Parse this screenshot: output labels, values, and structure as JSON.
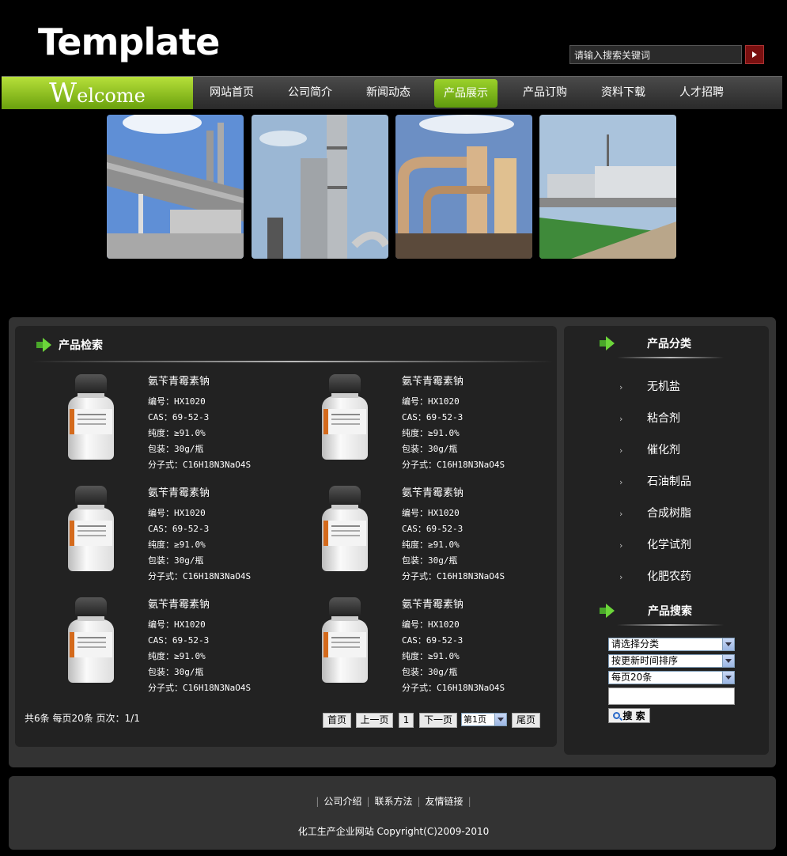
{
  "header": {
    "logo": "Template",
    "search_placeholder": "请输入搜索关键词"
  },
  "nav": {
    "welcome": "Welcome",
    "items": [
      {
        "label": "网站首页"
      },
      {
        "label": "公司简介"
      },
      {
        "label": "新闻动态"
      },
      {
        "label": "产品展示",
        "active": true
      },
      {
        "label": "产品订购"
      },
      {
        "label": "资料下载"
      },
      {
        "label": "人才招聘"
      }
    ]
  },
  "products_section": {
    "title": "产品检索",
    "items": [
      {
        "name": "氨苄青霉素钠",
        "code": "编号：HX1020",
        "cas": "CAS：69-52-3",
        "purity": "纯度：≥91.0%",
        "pack": "包装：30g/瓶",
        "formula": "分子式：C16H18N3NaO4S"
      },
      {
        "name": "氨苄青霉素钠",
        "code": "编号：HX1020",
        "cas": "CAS：69-52-3",
        "purity": "纯度：≥91.0%",
        "pack": "包装：30g/瓶",
        "formula": "分子式：C16H18N3NaO4S"
      },
      {
        "name": "氨苄青霉素钠",
        "code": "编号：HX1020",
        "cas": "CAS：69-52-3",
        "purity": "纯度：≥91.0%",
        "pack": "包装：30g/瓶",
        "formula": "分子式：C16H18N3NaO4S"
      },
      {
        "name": "氨苄青霉素钠",
        "code": "编号：HX1020",
        "cas": "CAS：69-52-3",
        "purity": "纯度：≥91.0%",
        "pack": "包装：30g/瓶",
        "formula": "分子式：C16H18N3NaO4S"
      },
      {
        "name": "氨苄青霉素钠",
        "code": "编号：HX1020",
        "cas": "CAS：69-52-3",
        "purity": "纯度：≥91.0%",
        "pack": "包装：30g/瓶",
        "formula": "分子式：C16H18N3NaO4S"
      },
      {
        "name": "氨苄青霉素钠",
        "code": "编号：HX1020",
        "cas": "CAS：69-52-3",
        "purity": "纯度：≥91.0%",
        "pack": "包装：30g/瓶",
        "formula": "分子式：C16H18N3NaO4S"
      }
    ]
  },
  "pager": {
    "info": "共6条 每页20条 页次：1/1",
    "first": "首页",
    "prev": "上一页",
    "current": "1",
    "next": "下一页",
    "page_select": "第1页",
    "last": "尾页"
  },
  "categories": {
    "title": "产品分类",
    "items": [
      "无机盐",
      "粘合剂",
      "催化剂",
      "石油制品",
      "合成树脂",
      "化学试剂",
      "化肥农药"
    ]
  },
  "product_search": {
    "title": "产品搜索",
    "category_select": "请选择分类",
    "sort_select": "按更新时间排序",
    "per_page_select": "每页20条",
    "search_button": "搜 索"
  },
  "footer": {
    "links": [
      "公司介绍",
      "联系方法",
      "友情链接"
    ],
    "copyright": "化工生产企业网站 Copyright(C)2009-2010"
  }
}
